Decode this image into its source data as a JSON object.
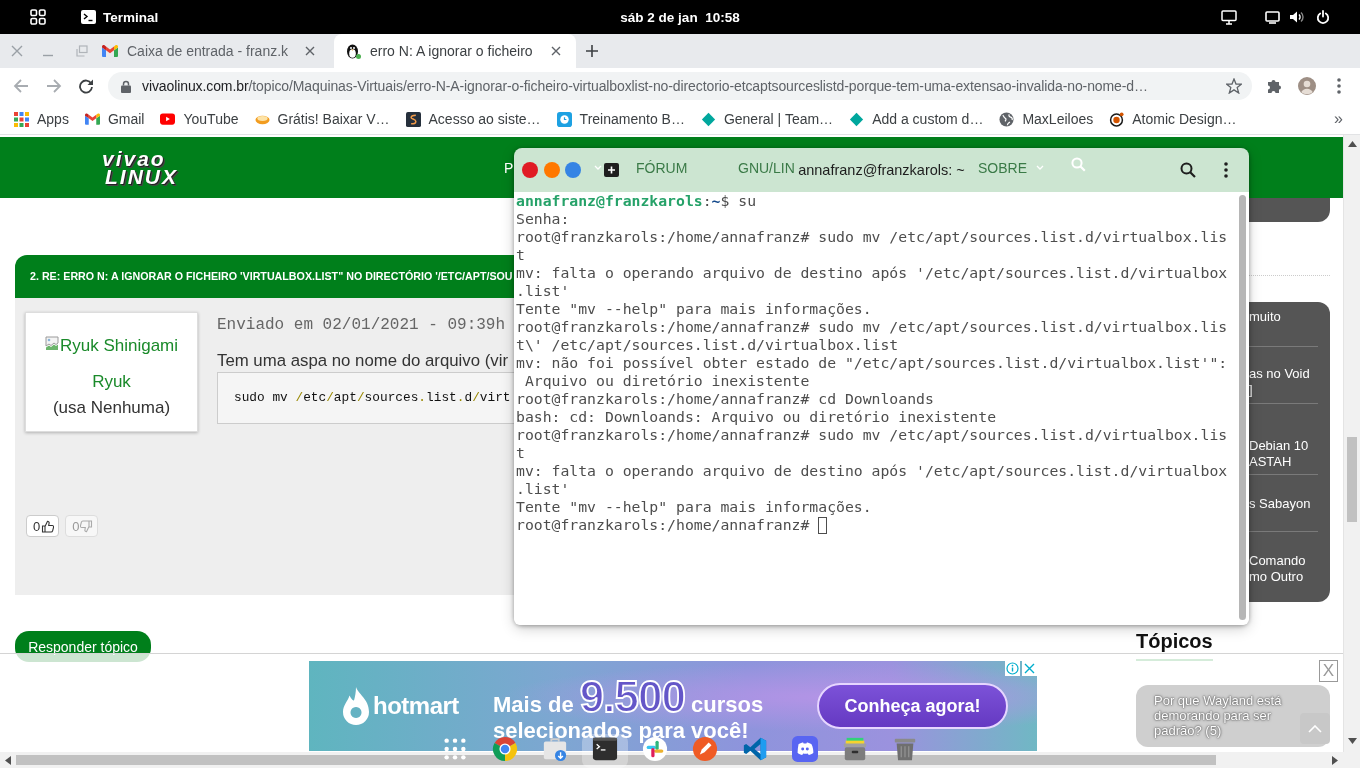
{
  "top_bar": {
    "app_name": "Terminal",
    "clock": "sáb 2 de jan  10:58"
  },
  "browser": {
    "tabs": [
      {
        "title": "Caixa de entrada - franz.k",
        "selected": false
      },
      {
        "title": "erro N: A ignorar o ficheiro",
        "selected": true
      }
    ],
    "back_disabled": true,
    "forward_disabled": true,
    "address": {
      "domain": "vivaolinux.com.br",
      "path": "/topico/Maquinas-Virtuais/erro-N-A-ignorar-o-ficheiro-virtualboxlist-no-directorio-etcaptsourceslistd-porque-tem-uma-extensao-invalida-no-nome-d…"
    },
    "bookmarks": [
      "Apps",
      "Gmail",
      "YouTube",
      "Grátis! Baixar V…",
      "Acesso ao siste…",
      "Treinamento B…",
      "General | Team…",
      "Add a custom d…",
      "MaxLeiloes",
      "Atomic Design…"
    ],
    "bookmarks_more": "»"
  },
  "site": {
    "logo": [
      "vivao",
      "LINUX"
    ],
    "nav": [
      {
        "kind": "link",
        "label": "P"
      },
      {
        "kind": "dropdown_arrow"
      },
      {
        "kind": "link",
        "label": "FÓRUM"
      },
      {
        "kind": "link",
        "label": "GNU/LIN"
      },
      {
        "kind": "link",
        "label": "SOBRE"
      },
      {
        "kind": "dropdown_arrow"
      }
    ],
    "post": {
      "heading": "2. RE: ERRO N: A IGNORAR O FICHEIRO 'VIRTUALBOX.LIST\" NO DIRECTÓRIO '/ETC/APT/SOU",
      "author": {
        "image_alt": "Ryuk Shinigami",
        "name": "Ryuk",
        "distro": "(usa Nenhuma)"
      },
      "sent": "Enviado em 02/01/2021 - 09:39h",
      "text": "Tem uma aspa no nome do arquivo (vir",
      "code": [
        {
          "text": "sudo mv ",
          "kind": "plain"
        },
        {
          "text": "/",
          "kind": "punct"
        },
        {
          "text": "etc",
          "kind": "plain"
        },
        {
          "text": "/",
          "kind": "punct"
        },
        {
          "text": "apt",
          "kind": "plain"
        },
        {
          "text": "/",
          "kind": "punct"
        },
        {
          "text": "sources",
          "kind": "plain"
        },
        {
          "text": ".",
          "kind": "punct"
        },
        {
          "text": "list",
          "kind": "plain"
        },
        {
          "text": ".",
          "kind": "punct"
        },
        {
          "text": "d",
          "kind": "plain"
        },
        {
          "text": "/",
          "kind": "punct"
        },
        {
          "text": "virt",
          "kind": "plain"
        }
      ],
      "votes": [
        {
          "count": "0",
          "kind": "up",
          "disabled": false
        },
        {
          "count": "0",
          "kind": "down",
          "disabled": true
        }
      ]
    },
    "reply_button": "Responder tópico",
    "sidebar": {
      "links": [
        {
          "lines": [
            "muito"
          ]
        },
        {
          "lines": [
            "as no Void",
            "]"
          ]
        },
        {
          "lines": [
            "Debian 10",
            "ASTAH"
          ]
        },
        {
          "lines": [
            "s Sabayon"
          ]
        },
        {
          "lines": [
            "Comando",
            "mo Outro"
          ]
        }
      ],
      "topics_heading": "Tópicos",
      "topics": [
        "Por que Wayland está demorando para ser padrão? (5)"
      ]
    },
    "ad": {
      "brand": "hotmart",
      "headline_lines": [
        [
          {
            "text": "Mais de",
            "kind": "plain"
          },
          {
            "text": "9.500",
            "kind": "outlined"
          },
          {
            "text": "cursos",
            "kind": "plain"
          }
        ],
        [
          {
            "text": "selecionados para você!",
            "kind": "plain"
          }
        ]
      ],
      "button": "Conheça agora!"
    },
    "ad_close": "X"
  },
  "terminal": {
    "title": "annafranz@franzkarols: ~",
    "lines": [
      {
        "kind": "prompt",
        "user": "annafranz@franzkarols",
        "separator": ":",
        "path": "~",
        "command": "$ su"
      },
      {
        "kind": "output",
        "text": "Senha:"
      },
      {
        "kind": "output",
        "text": "root@franzkarols:/home/annafranz# sudo mv /etc/apt/sources.list.d/virtualbox.lis"
      },
      {
        "kind": "output",
        "text": "t"
      },
      {
        "kind": "output",
        "text": "mv: falta o operando arquivo de destino após '/etc/apt/sources.list.d/virtualbox"
      },
      {
        "kind": "output",
        "text": ".list'"
      },
      {
        "kind": "output",
        "text": "Tente \"mv --help\" para mais informações."
      },
      {
        "kind": "output",
        "text": "root@franzkarols:/home/annafranz# sudo mv /etc/apt/sources.list.d/virtualbox.lis"
      },
      {
        "kind": "output",
        "text": "t\\' /etc/apt/sources.list.d/virtualbox.list"
      },
      {
        "kind": "output",
        "text": "mv: não foi possível obter estado de \"/etc/apt/sources.list.d/virtualbox.list'\":"
      },
      {
        "kind": "output",
        "text": " Arquivo ou diretório inexistente"
      },
      {
        "kind": "output",
        "text": "root@franzkarols:/home/annafranz# cd Downloands"
      },
      {
        "kind": "output",
        "text": "bash: cd: Downloands: Arquivo ou diretório inexistente"
      },
      {
        "kind": "output",
        "text": "root@franzkarols:/home/annafranz# sudo mv /etc/apt/sources.list.d/virtualbox.lis"
      },
      {
        "kind": "output",
        "text": "t"
      },
      {
        "kind": "output",
        "text": "mv: falta o operando arquivo de destino após '/etc/apt/sources.list.d/virtualbox"
      },
      {
        "kind": "output",
        "text": ".list'"
      },
      {
        "kind": "output",
        "text": "Tente \"mv --help\" para mais informações."
      },
      {
        "kind": "output",
        "text": "root@franzkarols:/home/annafranz#"
      }
    ],
    "cursor": true
  },
  "dock": {
    "apps": [
      {
        "selected": false
      },
      {
        "selected": false
      },
      {
        "selected": false
      },
      {
        "selected": true
      },
      {
        "selected": false
      },
      {
        "selected": false
      },
      {
        "selected": false
      },
      {
        "selected": false
      },
      {
        "selected": false
      },
      {
        "selected": false
      }
    ]
  }
}
